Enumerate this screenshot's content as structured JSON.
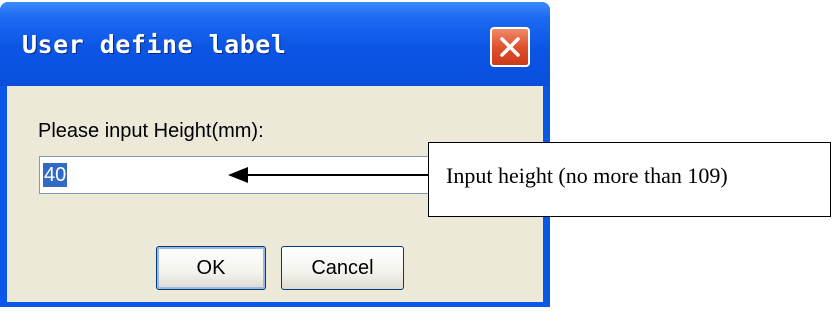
{
  "dialog": {
    "title": "User define label",
    "prompt_label": "Please input Height(mm):",
    "input_value": "40",
    "ok_label": "OK",
    "cancel_label": "Cancel"
  },
  "annotation": {
    "text": "Input height (no more than 109)"
  },
  "colors": {
    "titlebar": "#0a55e5",
    "close_button": "#e0512e",
    "client_background": "#ece9d8",
    "selection": "#316ac5"
  },
  "icons": {
    "close": "close-icon",
    "arrow": "arrow-left-icon"
  }
}
